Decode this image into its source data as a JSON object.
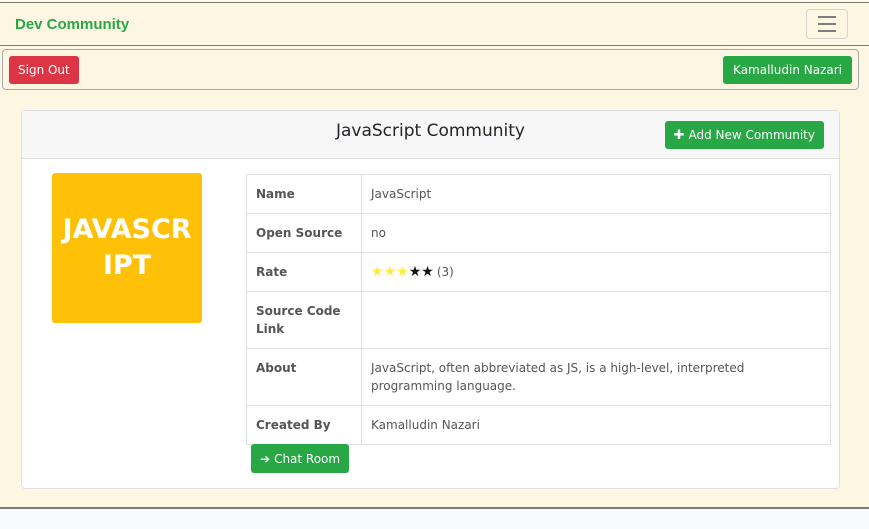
{
  "navbar": {
    "brand": "Dev Community",
    "menu_icon": "hamburger-menu-icon"
  },
  "userbar": {
    "signout_label": "Sign Out",
    "user_label": "Kamalludin Nazari"
  },
  "colors": {
    "brand_green": "#28a745",
    "danger_red": "#dc3545",
    "tile_yellow": "#ffc107",
    "page_bg": "#fdf6e3"
  },
  "community": {
    "title": "JavaScript Community",
    "add_button_label": "Add New Community",
    "add_icon": "plus-icon",
    "logo_text": "JAVASCRIPT",
    "fields": {
      "name_label": "Name",
      "name_value": "JavaScript",
      "open_source_label": "Open Source",
      "open_source_value": "no",
      "rate_label": "Rate",
      "rate_stars_filled": 3,
      "rate_stars_total": 5,
      "rate_count": "(3)",
      "source_label": "Source Code Link",
      "source_value": "",
      "about_label": "About",
      "about_value": "JavaScript, often abbreviated as JS, is a high-level, interpreted programming language.",
      "created_label": "Created By",
      "created_value": "Kamalludin Nazari"
    },
    "chat_button_label": "Chat Room",
    "chat_icon": "sign-in-icon"
  }
}
